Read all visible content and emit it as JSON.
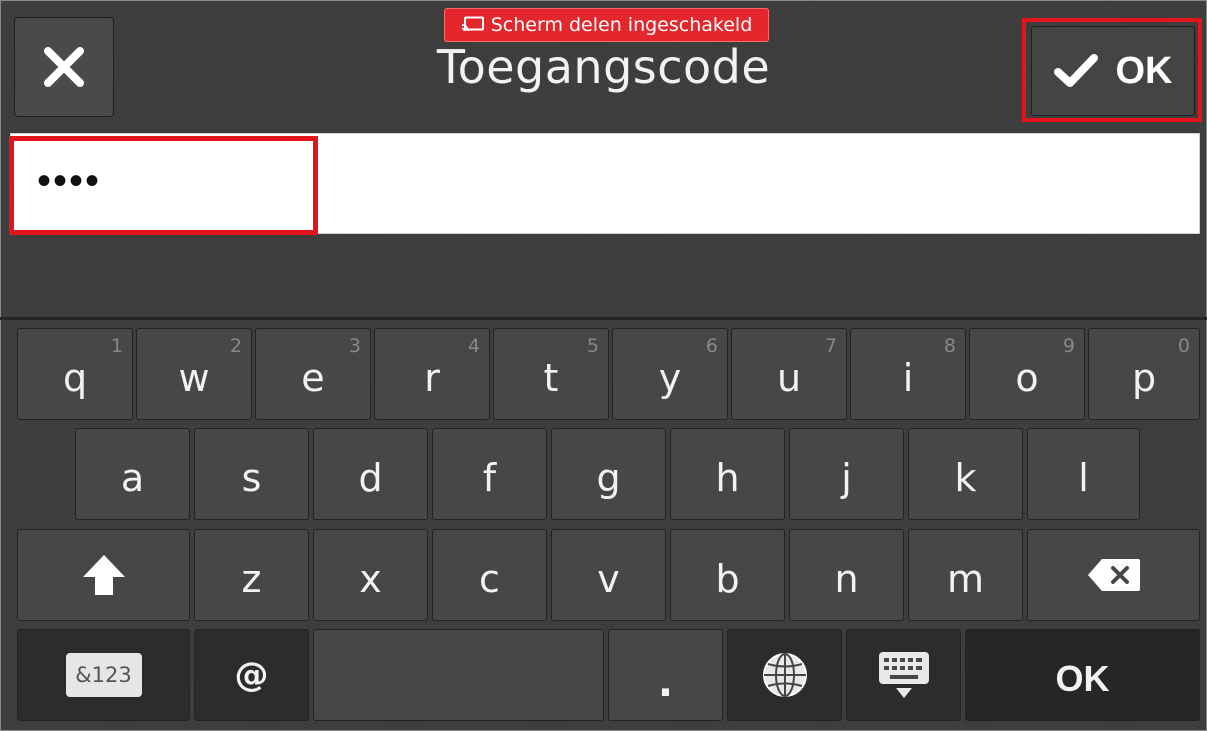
{
  "header": {
    "title": "Toegangscode",
    "share_badge": "Scherm delen ingeschakeld",
    "ok_label": "OK"
  },
  "input": {
    "value": "••••"
  },
  "keyboard": {
    "row1": [
      {
        "key": "q",
        "num": "1"
      },
      {
        "key": "w",
        "num": "2"
      },
      {
        "key": "e",
        "num": "3"
      },
      {
        "key": "r",
        "num": "4"
      },
      {
        "key": "t",
        "num": "5"
      },
      {
        "key": "y",
        "num": "6"
      },
      {
        "key": "u",
        "num": "7"
      },
      {
        "key": "i",
        "num": "8"
      },
      {
        "key": "o",
        "num": "9"
      },
      {
        "key": "p",
        "num": "0"
      }
    ],
    "row2": [
      "a",
      "s",
      "d",
      "f",
      "g",
      "h",
      "j",
      "k",
      "l"
    ],
    "row3": [
      "z",
      "x",
      "c",
      "v",
      "b",
      "n",
      "m"
    ],
    "row4": {
      "symbols_label": "&123",
      "at_label": "@",
      "period_label": ".",
      "ok_label": "OK"
    }
  },
  "icons": [
    "close-icon",
    "screen-share-icon",
    "checkmark-icon",
    "shift-icon",
    "backspace-icon",
    "globe-icon",
    "keyboard-hide-icon"
  ],
  "colors": {
    "highlight": "#e3141b",
    "badge": "#e3272d",
    "background": "#3b3b3b",
    "key": "#474747"
  }
}
